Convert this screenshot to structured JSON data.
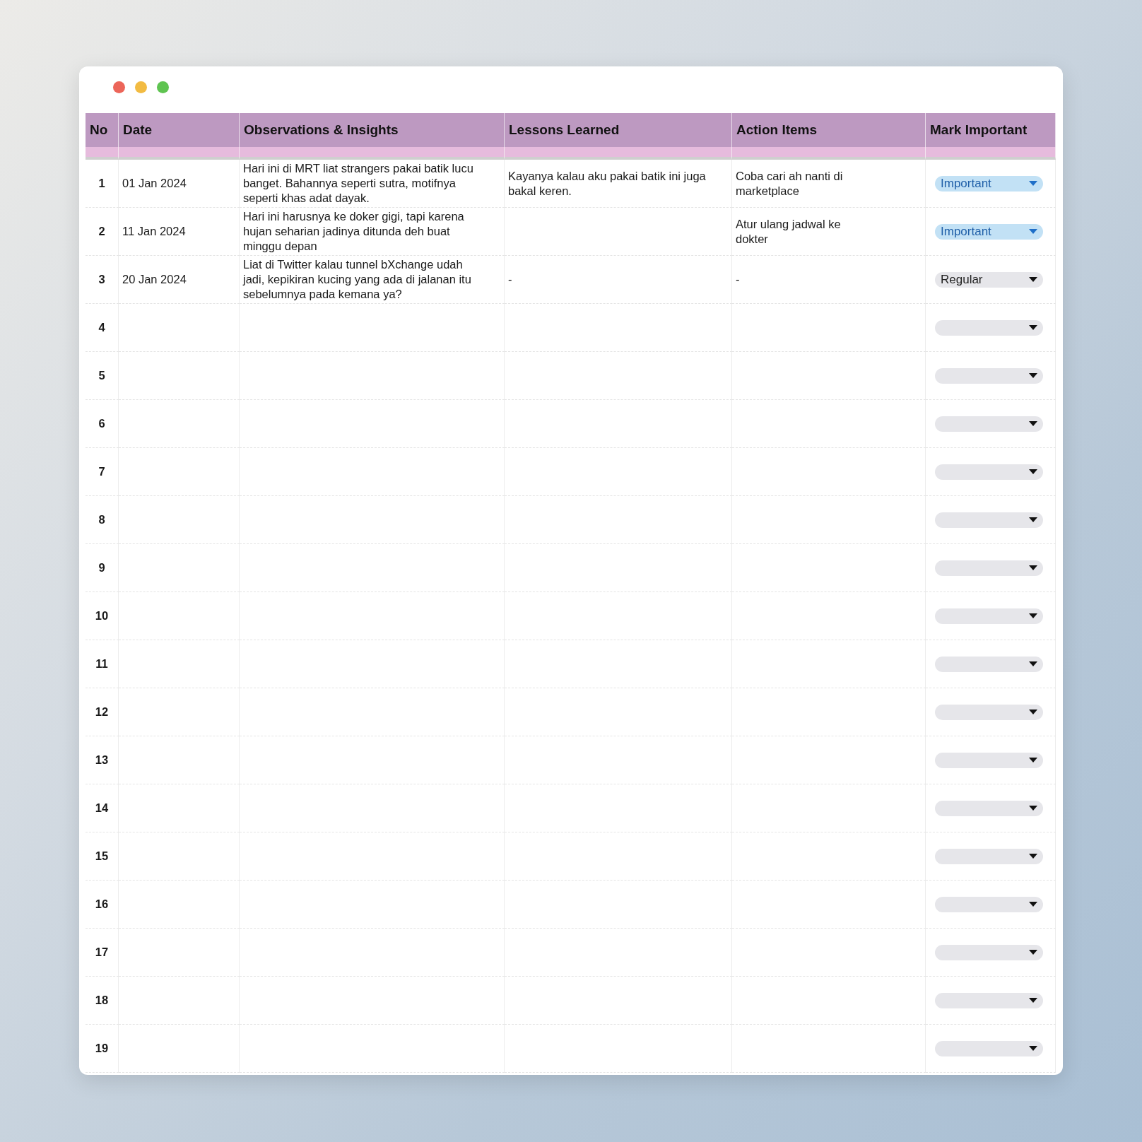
{
  "table": {
    "columns": [
      "No",
      "Date",
      "Observations & Insights",
      "Lessons Learned",
      "Action Items",
      "Mark Important"
    ],
    "rows": [
      {
        "no": "1",
        "date": "01 Jan 2024",
        "observation": "Hari ini di MRT liat strangers pakai batik lucu banget. Bahannya seperti sutra, motifnya seperti khas adat dayak.",
        "lesson": "Kayanya kalau aku pakai batik ini juga bakal keren.",
        "action": "Coba cari ah nanti di marketplace",
        "mark": {
          "kind": "important",
          "label": "Important"
        }
      },
      {
        "no": "2",
        "date": "11 Jan 2024",
        "observation": "Hari ini harusnya ke doker gigi, tapi karena hujan seharian jadinya ditunda deh buat minggu depan",
        "action": "Atur ulang jadwal ke dokter",
        "mark": {
          "kind": "important",
          "label": "Important"
        }
      },
      {
        "no": "3",
        "date": "20 Jan 2024",
        "observation": "Liat di Twitter kalau tunnel bXchange udah jadi, kepikiran kucing yang ada di jalanan itu sebelumnya pada kemana ya?",
        "lesson": "-",
        "action": "-",
        "mark": {
          "kind": "regular",
          "label": "Regular"
        }
      },
      {
        "no": "4",
        "mark": {
          "kind": "empty"
        }
      },
      {
        "no": "5",
        "mark": {
          "kind": "empty"
        }
      },
      {
        "no": "6",
        "mark": {
          "kind": "empty"
        }
      },
      {
        "no": "7",
        "mark": {
          "kind": "empty"
        }
      },
      {
        "no": "8",
        "mark": {
          "kind": "empty"
        }
      },
      {
        "no": "9",
        "mark": {
          "kind": "empty"
        }
      },
      {
        "no": "10",
        "mark": {
          "kind": "empty"
        }
      },
      {
        "no": "11",
        "mark": {
          "kind": "empty"
        }
      },
      {
        "no": "12",
        "mark": {
          "kind": "empty"
        }
      },
      {
        "no": "13",
        "mark": {
          "kind": "empty"
        }
      },
      {
        "no": "14",
        "mark": {
          "kind": "empty"
        }
      },
      {
        "no": "15",
        "mark": {
          "kind": "empty"
        }
      },
      {
        "no": "16",
        "mark": {
          "kind": "empty"
        }
      },
      {
        "no": "17",
        "mark": {
          "kind": "empty"
        }
      },
      {
        "no": "18",
        "mark": {
          "kind": "empty"
        }
      },
      {
        "no": "19",
        "mark": {
          "kind": "empty"
        }
      }
    ]
  }
}
